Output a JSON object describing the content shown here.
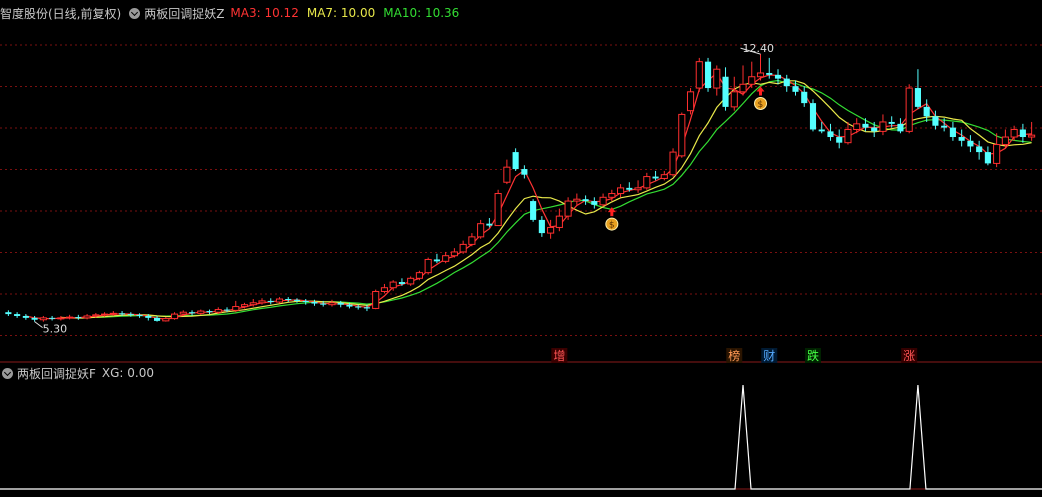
{
  "header": {
    "stock_title": "智度股份(日线,前复权)",
    "indicator_name": "两板回调捉妖Z",
    "ma3": {
      "label": "MA3: 10.12",
      "color": "#ff3333"
    },
    "ma7": {
      "label": "MA7: 10.00",
      "color": "#e8e84a"
    },
    "ma10": {
      "label": "MA10: 10.36",
      "color": "#33dd33"
    }
  },
  "sub_header": {
    "indicator_name": "两板回调捉妖F",
    "xg_label": "XG: 0.00"
  },
  "colors": {
    "up": "#ff2f2f",
    "down": "#54ffff",
    "grid": "#7a1010",
    "signal": "#ffffff"
  },
  "annotations": {
    "high_label": "12.40",
    "low_label": "5.30",
    "markers": [
      {
        "text": "增",
        "index": 63,
        "color": "#ff5555",
        "bg": "#3a0000"
      },
      {
        "text": "榜",
        "index": 83,
        "color": "#ff9955",
        "bg": "#2a1400"
      },
      {
        "text": "财",
        "index": 87,
        "color": "#55aaff",
        "bg": "#001a33"
      },
      {
        "text": "跌",
        "index": 92,
        "color": "#44ff44",
        "bg": "#002200"
      },
      {
        "text": "涨",
        "index": 103,
        "color": "#ff5555",
        "bg": "#330000"
      }
    ],
    "buy_signals": [
      69,
      86
    ]
  },
  "chart_data": {
    "type": "candlestick",
    "ylim": [
      4.6,
      13.2
    ],
    "candles": [
      [
        5.55,
        5.5,
        5.6,
        5.45
      ],
      [
        5.5,
        5.45,
        5.55,
        5.4
      ],
      [
        5.45,
        5.4,
        5.5,
        5.35
      ],
      [
        5.4,
        5.35,
        5.45,
        5.3
      ],
      [
        5.35,
        5.4,
        5.45,
        5.3
      ],
      [
        5.4,
        5.38,
        5.45,
        5.33
      ],
      [
        5.38,
        5.4,
        5.45,
        5.33
      ],
      [
        5.4,
        5.42,
        5.48,
        5.36
      ],
      [
        5.42,
        5.4,
        5.48,
        5.35
      ],
      [
        5.4,
        5.45,
        5.5,
        5.36
      ],
      [
        5.45,
        5.48,
        5.53,
        5.4
      ],
      [
        5.48,
        5.5,
        5.55,
        5.43
      ],
      [
        5.5,
        5.52,
        5.58,
        5.45
      ],
      [
        5.52,
        5.5,
        5.58,
        5.45
      ],
      [
        5.5,
        5.48,
        5.55,
        5.43
      ],
      [
        5.48,
        5.45,
        5.52,
        5.4
      ],
      [
        5.45,
        5.4,
        5.5,
        5.33
      ],
      [
        5.4,
        5.32,
        5.45,
        5.3
      ],
      [
        5.32,
        5.38,
        5.42,
        5.3
      ],
      [
        5.38,
        5.5,
        5.55,
        5.35
      ],
      [
        5.5,
        5.55,
        5.6,
        5.45
      ],
      [
        5.55,
        5.52,
        5.6,
        5.46
      ],
      [
        5.52,
        5.58,
        5.62,
        5.48
      ],
      [
        5.58,
        5.55,
        5.62,
        5.5
      ],
      [
        5.55,
        5.62,
        5.68,
        5.5
      ],
      [
        5.62,
        5.6,
        5.68,
        5.55
      ],
      [
        5.6,
        5.7,
        5.85,
        5.55
      ],
      [
        5.7,
        5.75,
        5.8,
        5.65
      ],
      [
        5.75,
        5.8,
        5.9,
        5.7
      ],
      [
        5.8,
        5.85,
        5.92,
        5.75
      ],
      [
        5.85,
        5.82,
        5.92,
        5.76
      ],
      [
        5.82,
        5.9,
        5.95,
        5.78
      ],
      [
        5.9,
        5.88,
        5.95,
        5.82
      ],
      [
        5.88,
        5.85,
        5.92,
        5.8
      ],
      [
        5.85,
        5.82,
        5.9,
        5.75
      ],
      [
        5.82,
        5.78,
        5.88,
        5.72
      ],
      [
        5.78,
        5.75,
        5.85,
        5.7
      ],
      [
        5.75,
        5.8,
        5.88,
        5.7
      ],
      [
        5.8,
        5.75,
        5.85,
        5.68
      ],
      [
        5.75,
        5.7,
        5.8,
        5.65
      ],
      [
        5.7,
        5.68,
        5.75,
        5.62
      ],
      [
        5.68,
        5.65,
        5.75,
        5.58
      ],
      [
        5.65,
        6.1,
        6.15,
        5.63
      ],
      [
        6.1,
        6.2,
        6.3,
        6.05
      ],
      [
        6.2,
        6.35,
        6.4,
        6.12
      ],
      [
        6.35,
        6.3,
        6.45,
        6.25
      ],
      [
        6.3,
        6.45,
        6.5,
        6.25
      ],
      [
        6.45,
        6.6,
        6.65,
        6.4
      ],
      [
        6.6,
        6.95,
        7.0,
        6.55
      ],
      [
        6.95,
        6.9,
        7.1,
        6.85
      ],
      [
        6.9,
        7.05,
        7.15,
        6.85
      ],
      [
        7.05,
        7.15,
        7.25,
        7.0
      ],
      [
        7.15,
        7.35,
        7.45,
        7.1
      ],
      [
        7.35,
        7.55,
        7.65,
        7.3
      ],
      [
        7.55,
        7.9,
        8.0,
        7.5
      ],
      [
        7.9,
        7.85,
        8.05,
        7.8
      ],
      [
        7.85,
        8.7,
        8.8,
        7.85
      ],
      [
        9.0,
        9.4,
        9.6,
        8.95
      ],
      [
        9.8,
        9.35,
        9.9,
        9.3
      ],
      [
        9.35,
        9.2,
        9.45,
        9.1
      ],
      [
        8.5,
        8.0,
        8.55,
        7.95
      ],
      [
        8.0,
        7.65,
        8.1,
        7.55
      ],
      [
        7.65,
        7.8,
        8.0,
        7.5
      ],
      [
        7.8,
        8.1,
        8.3,
        7.7
      ],
      [
        8.1,
        8.5,
        8.6,
        8.0
      ],
      [
        8.5,
        8.55,
        8.7,
        8.4
      ],
      [
        8.55,
        8.5,
        8.65,
        8.4
      ],
      [
        8.5,
        8.4,
        8.6,
        8.3
      ],
      [
        8.4,
        8.6,
        8.7,
        8.35
      ],
      [
        8.6,
        8.7,
        8.8,
        8.5
      ],
      [
        8.7,
        8.85,
        8.95,
        8.6
      ],
      [
        8.85,
        8.8,
        9.0,
        8.75
      ],
      [
        8.8,
        8.85,
        9.05,
        8.72
      ],
      [
        8.85,
        9.15,
        9.25,
        8.8
      ],
      [
        9.15,
        9.1,
        9.3,
        9.05
      ],
      [
        9.1,
        9.2,
        9.3,
        9.05
      ],
      [
        9.2,
        9.8,
        9.9,
        9.15
      ],
      [
        9.7,
        10.8,
        10.85,
        9.65
      ],
      [
        10.9,
        11.4,
        11.5,
        10.8
      ],
      [
        11.5,
        12.2,
        12.3,
        11.4
      ],
      [
        12.2,
        11.5,
        12.3,
        11.4
      ],
      [
        11.5,
        12.0,
        12.1,
        11.3
      ],
      [
        11.8,
        11.0,
        12.05,
        10.9
      ],
      [
        11.0,
        11.4,
        11.8,
        10.9
      ],
      [
        11.4,
        11.6,
        12.1,
        11.3
      ],
      [
        11.6,
        11.8,
        12.2,
        11.5
      ],
      [
        11.8,
        11.9,
        12.4,
        11.7
      ],
      [
        11.9,
        11.85,
        12.3,
        11.75
      ],
      [
        11.85,
        11.75,
        12.0,
        11.6
      ],
      [
        11.75,
        11.55,
        11.85,
        11.4
      ],
      [
        11.55,
        11.4,
        11.7,
        11.3
      ],
      [
        11.4,
        11.1,
        11.55,
        11.0
      ],
      [
        11.1,
        10.4,
        11.2,
        10.35
      ],
      [
        10.4,
        10.35,
        10.6,
        10.3
      ],
      [
        10.35,
        10.2,
        10.55,
        10.1
      ],
      [
        10.2,
        10.05,
        10.4,
        9.9
      ],
      [
        10.05,
        10.4,
        10.6,
        10.0
      ],
      [
        10.4,
        10.55,
        10.7,
        10.3
      ],
      [
        10.55,
        10.45,
        10.7,
        10.35
      ],
      [
        10.45,
        10.35,
        10.6,
        10.2
      ],
      [
        10.35,
        10.6,
        10.8,
        10.25
      ],
      [
        10.6,
        10.55,
        10.75,
        10.45
      ],
      [
        10.55,
        10.35,
        10.7,
        10.3
      ],
      [
        10.35,
        11.5,
        11.6,
        10.3
      ],
      [
        11.5,
        11.0,
        12.0,
        10.95
      ],
      [
        11.0,
        10.75,
        11.2,
        10.6
      ],
      [
        10.75,
        10.5,
        10.9,
        10.4
      ],
      [
        10.5,
        10.45,
        10.7,
        10.35
      ],
      [
        10.45,
        10.2,
        10.6,
        10.1
      ],
      [
        10.2,
        10.1,
        10.4,
        9.95
      ],
      [
        10.1,
        9.95,
        10.25,
        9.8
      ],
      [
        9.95,
        9.8,
        10.1,
        9.6
      ],
      [
        9.8,
        9.5,
        9.95,
        9.45
      ],
      [
        9.5,
        10.0,
        10.3,
        9.4
      ],
      [
        10.0,
        10.2,
        10.4,
        9.9
      ],
      [
        10.2,
        10.4,
        10.5,
        10.1
      ],
      [
        10.4,
        10.2,
        10.55,
        10.05
      ],
      [
        10.2,
        10.25,
        10.6,
        10.1
      ]
    ]
  },
  "sub_chart_data": {
    "type": "line",
    "spikes_at": [
      84,
      104
    ],
    "ylim": [
      0,
      1
    ]
  }
}
